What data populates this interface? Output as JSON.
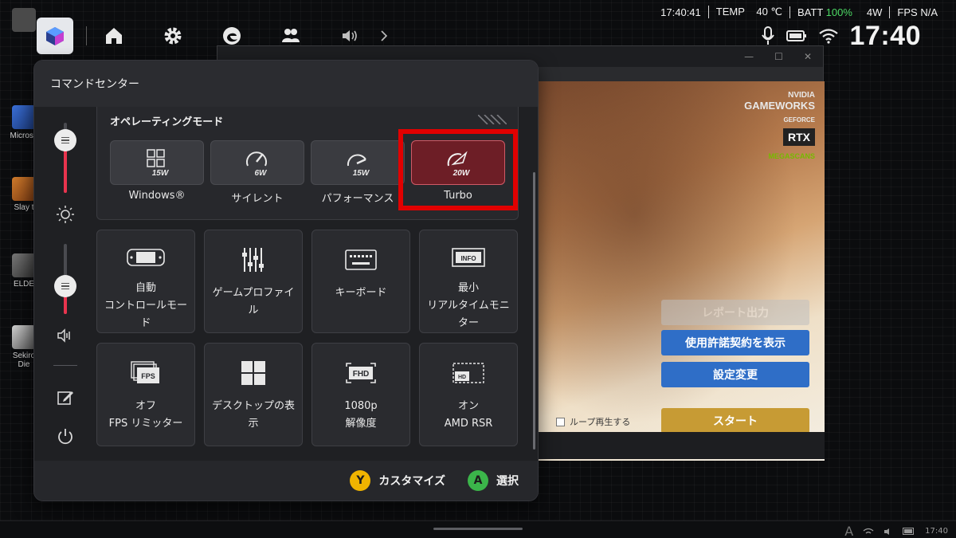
{
  "status_bar": {
    "time": "17:40:41",
    "temp_label": "TEMP",
    "temp_value": "40 ℃",
    "batt_label": "BATT",
    "batt_value": "100%",
    "power": "4W",
    "fps": "FPS N/A",
    "colors": {
      "batt_value": "#4cd964"
    }
  },
  "top_clock": "17:40",
  "toolbar": {
    "icons": [
      "app-launcher-icon",
      "home-icon",
      "gear-icon",
      "edge-browser-icon",
      "people-icon",
      "speaker-icon",
      "chevron-right-icon",
      "microphone-icon",
      "battery-icon",
      "wifi-icon"
    ]
  },
  "desktop_icons": [
    {
      "label": "Microso"
    },
    {
      "label": "Slay t"
    },
    {
      "label": "ELDE"
    },
    {
      "label": "Sekiro"
    },
    {
      "label": "Die"
    }
  ],
  "background_window": {
    "buttons": {
      "report": "レポート出力",
      "license": "使用許諾契約を表示",
      "settings": "設定変更",
      "start": "スタート"
    },
    "loop_label": "ループ再生する",
    "badge": {
      "brand": "NVIDIA",
      "gameworks": "GAMEWORKS",
      "rtx_line": "GEFORCE",
      "rtx": "RTX",
      "mega": "MEGASCANS"
    }
  },
  "panel": {
    "title": "コマンドセンター",
    "operating_mode": {
      "title": "オペレーティングモード",
      "modes": [
        {
          "label": "Windows®",
          "watts": "15W",
          "icon": "windows-grid-icon",
          "active": false
        },
        {
          "label": "サイレント",
          "watts": "6W",
          "icon": "gauge-low-icon",
          "active": false
        },
        {
          "label": "パフォーマンス",
          "watts": "15W",
          "icon": "gauge-mid-icon",
          "active": false
        },
        {
          "label": "Turbo",
          "watts": "20W",
          "icon": "gauge-turbo-icon",
          "active": true
        }
      ],
      "colors": {
        "active_bg": "#6d1e26",
        "highlight": "#e10000"
      }
    },
    "tiles": [
      {
        "line1": "自動",
        "line2": "コントロールモード",
        "icon": "handheld-console-icon"
      },
      {
        "line1": "",
        "line2": "ゲームプロファイル",
        "icon": "equalizer-sliders-icon"
      },
      {
        "line1": "",
        "line2": "キーボード",
        "icon": "keyboard-icon"
      },
      {
        "line1": "最小",
        "line2": "リアルタイムモニター",
        "icon": "info-monitor-icon"
      },
      {
        "line1": "オフ",
        "line2": "FPS リミッター",
        "icon": "fps-stack-icon"
      },
      {
        "line1": "",
        "line2": "デスクトップの表示",
        "icon": "windows-logo-icon"
      },
      {
        "line1": "1080p",
        "line2": "解像度",
        "icon": "fhd-icon"
      },
      {
        "line1": "オン",
        "line2": "AMD RSR",
        "icon": "hd-rsr-icon"
      }
    ],
    "sliders": {
      "brightness_fraction": 0.75,
      "volume_fraction": 0.4
    },
    "rail_icons": [
      "sun-brightness-icon",
      "speaker-volume-icon",
      "edit-icon",
      "power-icon"
    ],
    "footer": {
      "y_key": "Y",
      "y_label": "カスタマイズ",
      "a_key": "A",
      "a_label": "選択",
      "colors": {
        "y": "#f0b400",
        "a": "#3bb54a"
      }
    }
  },
  "taskbar": {
    "tray_time": "17:40"
  }
}
